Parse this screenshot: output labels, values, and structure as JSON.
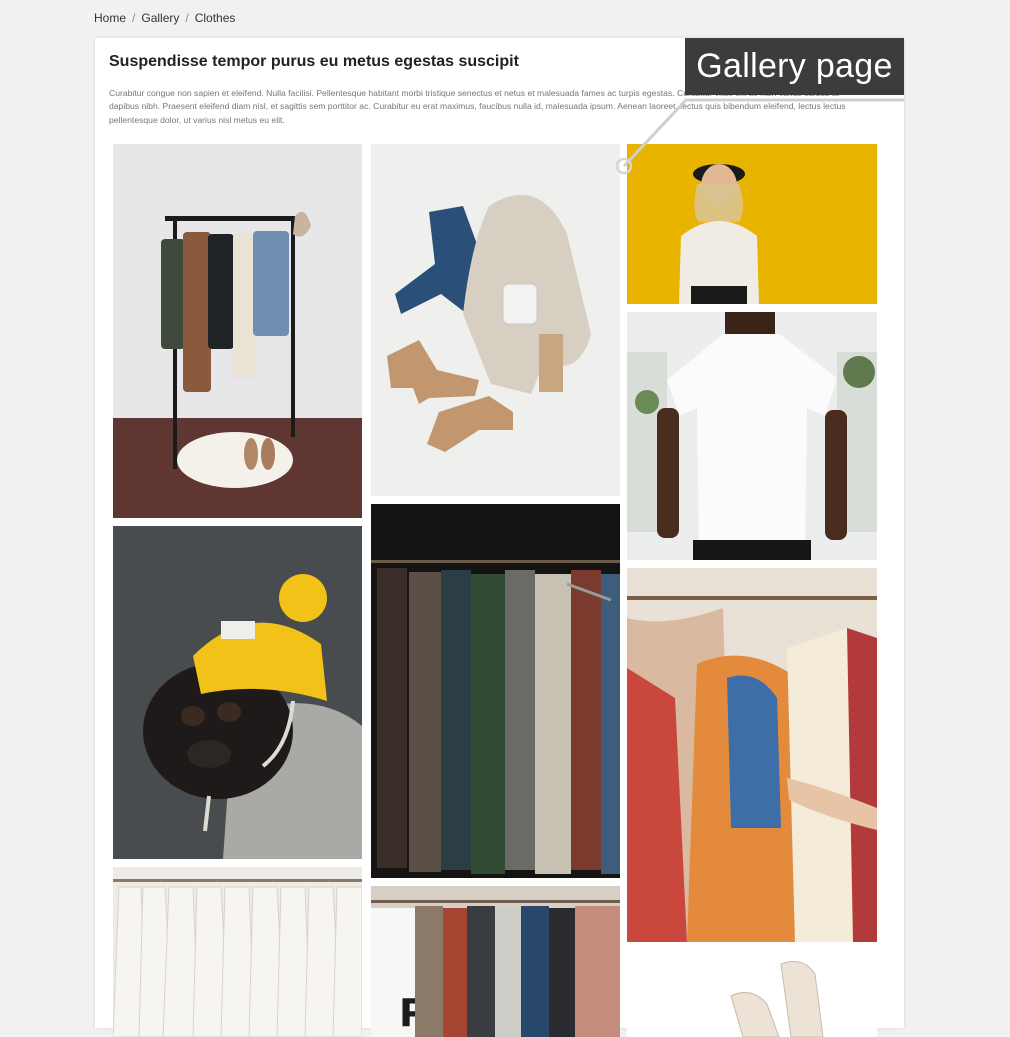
{
  "breadcrumb": {
    "home": "Home",
    "gallery": "Gallery",
    "current": "Clothes",
    "separator": "/"
  },
  "page": {
    "title": "Suspendisse tempor purus eu metus egestas suscipit",
    "description": "Curabitur congue non sapien et eleifend. Nulla facilisi. Pellentesque habitant morbi tristique senectus et netus et malesuada fames ac turpis egestas. Curabitur vitae elit ac nibh varius cursus at dapibus nibh. Praesent eleifend diam nisl, et sagittis sem porttitor ac. Curabitur eu erat maximus, faucibus nulla id, malesuada ipsum. Aenean laoreet, lectus quis bibendum eleifend, lectus lectus pellentesque dolor, ut varius nisl metus eu elit."
  },
  "callout": {
    "label": "Gallery page"
  },
  "colors": {
    "background": "#f1f1f1",
    "card": "#ffffff",
    "callout_bg": "#3c3c3c",
    "mustard": "#e8b400"
  }
}
